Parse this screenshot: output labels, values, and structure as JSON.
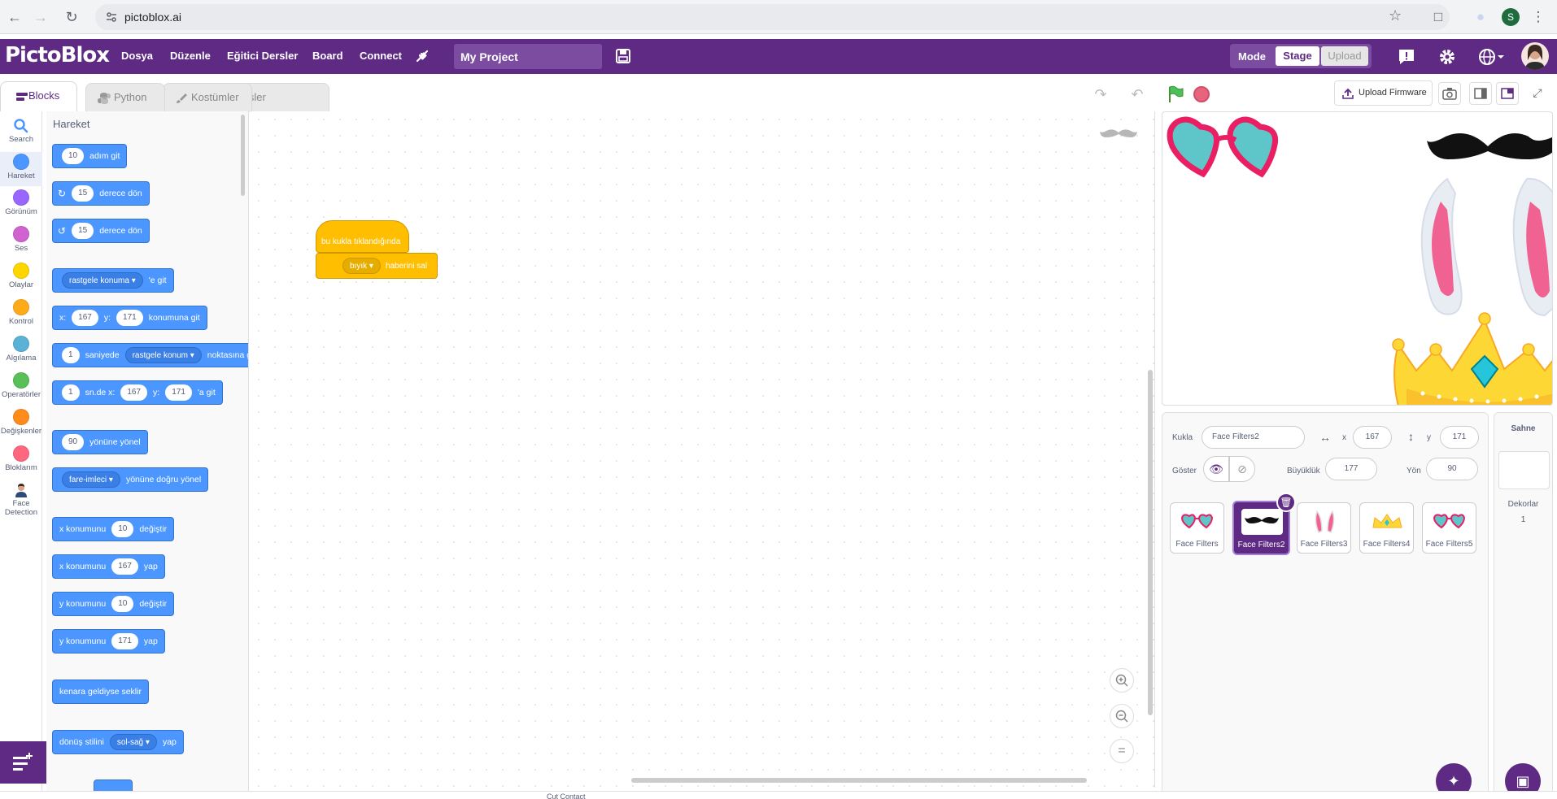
{
  "browser": {
    "url": "pictoblox.ai",
    "profile_initial": "S"
  },
  "app": {
    "logo": "PictoBlox",
    "menu": [
      "Dosya",
      "Düzenle",
      "Eğitici Dersler",
      "Board",
      "Connect"
    ],
    "project_name": "My Project",
    "mode_label": "Mode",
    "mode_stage": "Stage",
    "mode_upload": "Upload",
    "brand_color": "#5e2a84"
  },
  "tabs": [
    {
      "label": "Blocks",
      "icon": "blocks-icon",
      "active": true
    },
    {
      "label": "Python",
      "icon": "python-icon",
      "active": false
    },
    {
      "label": "Kostümler",
      "icon": "brush-icon",
      "active": false
    },
    {
      "label": "Sesler",
      "icon": "speaker-icon",
      "active": false
    }
  ],
  "categories": [
    {
      "label": "Search",
      "color": "#4c97ff",
      "icon": "search-icon"
    },
    {
      "label": "Hareket",
      "color": "#4c97ff",
      "selected": true
    },
    {
      "label": "Görünüm",
      "color": "#9966ff"
    },
    {
      "label": "Ses",
      "color": "#cf63cf"
    },
    {
      "label": "Olaylar",
      "color": "#ffd500"
    },
    {
      "label": "Kontrol",
      "color": "#ffab19"
    },
    {
      "label": "Algılama",
      "color": "#5cb1d6"
    },
    {
      "label": "Operatörler",
      "color": "#59c059"
    },
    {
      "label": "Değişkenler",
      "color": "#ff8c1a"
    },
    {
      "label": "Bloklarım",
      "color": "#ff6680"
    },
    {
      "label": "Face Detection",
      "icon": "face-detection-icon"
    }
  ],
  "palette": {
    "title": "Hareket",
    "blocks": {
      "move": {
        "value": "10",
        "text": "adım git"
      },
      "turn_right": {
        "value": "15",
        "text": "derece dön"
      },
      "turn_left": {
        "value": "15",
        "text": "derece dön"
      },
      "goto": {
        "dropdown": "rastgele konuma",
        "text": "'e git"
      },
      "goto_xy": {
        "x_label": "x:",
        "x": "167",
        "y_label": "y:",
        "y": "171",
        "text": "konumuna git"
      },
      "glide": {
        "value": "1",
        "text1": "saniyede",
        "dropdown": "rastgele konum",
        "text2": "noktasına git"
      },
      "glide_xy": {
        "value": "1",
        "text1": "sn.de x:",
        "x": "167",
        "y_label": "y:",
        "y": "171",
        "text2": "'a git"
      },
      "point_dir": {
        "value": "90",
        "text": "yönüne yönel"
      },
      "point_towards": {
        "dropdown": "fare-imleci",
        "text": "yönüne doğru yönel"
      },
      "change_x": {
        "text1": "x konumunu",
        "value": "10",
        "text2": "değiştir"
      },
      "set_x": {
        "text1": "x konumunu",
        "value": "167",
        "text2": "yap"
      },
      "change_y": {
        "text1": "y konumunu",
        "value": "10",
        "text2": "değiştir"
      },
      "set_y": {
        "text1": "y konumunu",
        "value": "171",
        "text2": "yap"
      },
      "bounce": {
        "text": "kenara geldiyse seklir"
      },
      "rotation_style": {
        "text1": "dönüş stilini",
        "dropdown": "sol-sağ",
        "text2": "yap"
      }
    }
  },
  "script": {
    "hat_text": "bu kukla tıklandığında",
    "broadcast_dropdown": "bıyık",
    "broadcast_text": "haberini sal"
  },
  "toolbar": {
    "upload_firmware": "Upload Firmware"
  },
  "sprite_info": {
    "sprite_label": "Kukla",
    "sprite_name": "Face Filters2",
    "x_label": "x",
    "x": "167",
    "y_label": "y",
    "y": "171",
    "show_label": "Göster",
    "size_label": "Büyüklük",
    "size": "177",
    "direction_label": "Yön",
    "direction": "90"
  },
  "sprites": [
    {
      "name": "Face Filters",
      "icon": "heart-glasses-icon"
    },
    {
      "name": "Face Filters2",
      "icon": "mustache-icon",
      "selected": true
    },
    {
      "name": "Face Filters3",
      "icon": "bunny-ears-icon"
    },
    {
      "name": "Face Filters4",
      "icon": "crown-icon"
    },
    {
      "name": "Face Filters5",
      "icon": "heart-glasses-icon"
    }
  ],
  "stage_panel": {
    "title": "Sahne",
    "backdrops_label": "Dekorlar",
    "backdrops_count": "1"
  },
  "status_bar": "Cut Contact"
}
